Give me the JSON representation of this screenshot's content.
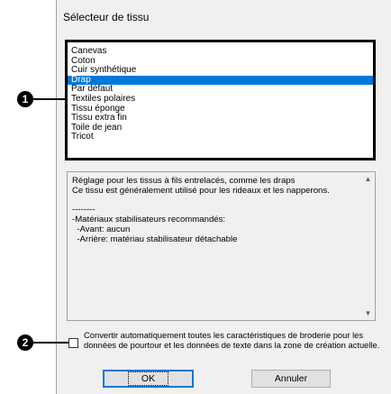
{
  "dialog": {
    "title": "Sélecteur de tissu"
  },
  "fabric_list": {
    "items": [
      "Canevas",
      "Coton",
      "Cuir synthétique",
      "Drap",
      "Par défaut",
      "Textiles polaires",
      "Tissu éponge",
      "Tissu extra fin",
      "Toile de jean",
      "Tricot"
    ],
    "selected_index": 3
  },
  "description": {
    "text": "Réglage pour les tissus à fils entrelacés, comme les draps\nCe tissu est généralement utilisé pour les rideaux et les napperons.\n\n--------\n-Matériaux stabilisateurs recommandés:\n  -Avant: aucun\n  -Arrière: matériau stabilisateur détachable"
  },
  "convert_option": {
    "label": "Convertir automatiquement toutes les caractéristiques de broderie pour les données de pourtour et les données de texte dans la zone de création actuelle.",
    "checked": false
  },
  "buttons": {
    "ok": "OK",
    "cancel": "Annuler"
  },
  "callouts": {
    "one": "1",
    "two": "2"
  },
  "colors": {
    "selection": "#0078d7",
    "dialog_bg": "#f0f0f0"
  }
}
